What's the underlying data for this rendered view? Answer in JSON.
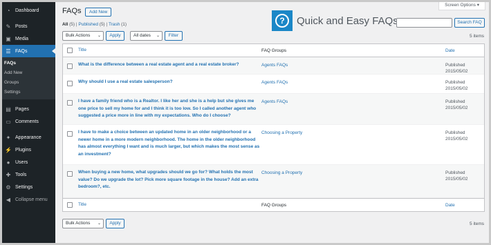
{
  "sidebar": {
    "items": [
      {
        "label": "Dashboard",
        "icon": "dashboard-icon",
        "glyph": "◔"
      },
      {
        "label": "Posts",
        "icon": "pin-icon",
        "glyph": "✎"
      },
      {
        "label": "Media",
        "icon": "media-icon",
        "glyph": "▣"
      },
      {
        "label": "FAQs",
        "icon": "faq-icon",
        "glyph": "☰"
      },
      {
        "label": "Pages",
        "icon": "pages-icon",
        "glyph": "▤"
      },
      {
        "label": "Comments",
        "icon": "comments-icon",
        "glyph": "▭"
      },
      {
        "label": "Appearance",
        "icon": "appearance-icon",
        "glyph": "✦"
      },
      {
        "label": "Plugins",
        "icon": "plugins-icon",
        "glyph": "⚡"
      },
      {
        "label": "Users",
        "icon": "users-icon",
        "glyph": "●"
      },
      {
        "label": "Tools",
        "icon": "tools-icon",
        "glyph": "✚"
      },
      {
        "label": "Settings",
        "icon": "settings-icon",
        "glyph": "⚙"
      },
      {
        "label": "Collapse menu",
        "icon": "collapse-icon",
        "glyph": "◀"
      }
    ],
    "submenu": [
      "FAQs",
      "Add New",
      "Groups",
      "Settings"
    ]
  },
  "header": {
    "screen_options": "Screen Options",
    "title": "FAQs",
    "add_new": "Add New"
  },
  "filters": {
    "all_label": "All",
    "all_count": "(5)",
    "published_label": "Published",
    "published_count": "(5)",
    "trash_label": "Trash",
    "trash_count": "(1)",
    "separator": "|"
  },
  "logo": {
    "text": "Quick and Easy FAQs",
    "mark": "?"
  },
  "search": {
    "button": "Search FAQ",
    "placeholder": ""
  },
  "toolbar": {
    "bulk_actions": "Bulk Actions",
    "apply": "Apply",
    "all_dates": "All dates",
    "filter": "Filter",
    "items_count": "5 items"
  },
  "table": {
    "columns": {
      "title": "Title",
      "groups": "FAQ Groups",
      "date": "Date"
    },
    "rows": [
      {
        "title": "What is the difference between a real estate agent and a real estate broker?",
        "group": "Agents FAQs",
        "status": "Published",
        "date": "2015/05/02"
      },
      {
        "title": "Why should I use a real estate salesperson?",
        "group": "Agents FAQs",
        "status": "Published",
        "date": "2015/05/02"
      },
      {
        "title": "I have a family friend who is a Realtor. I like her and she is a help but she gives me one price to sell my home for and I think it is too low. So I called another agent who suggested a price more in line with my expectations. Who do I choose?",
        "group": "Agents FAQs",
        "status": "Published",
        "date": "2015/05/02"
      },
      {
        "title": "I have to make a choice between an updated home in an older neighborhood or a newer home in a more modern neighborhood. The home in the older neighborhood has almost everything I want and is much larger, but which makes the most sense as an investment?",
        "group": "Choosing a Property",
        "status": "Published",
        "date": "2015/05/02"
      },
      {
        "title": "When buying a new home, what upgrades should we go for? What holds the most value? Do we upgrade the lot? Pick more square footage in the house? Add an extra bedroom?, etc.",
        "group": "Choosing a Property",
        "status": "Published",
        "date": "2015/05/02"
      }
    ]
  },
  "colors": {
    "sidebar_bg": "#1d2327",
    "accent": "#2271b1",
    "logo_bg": "#1b87c7"
  }
}
